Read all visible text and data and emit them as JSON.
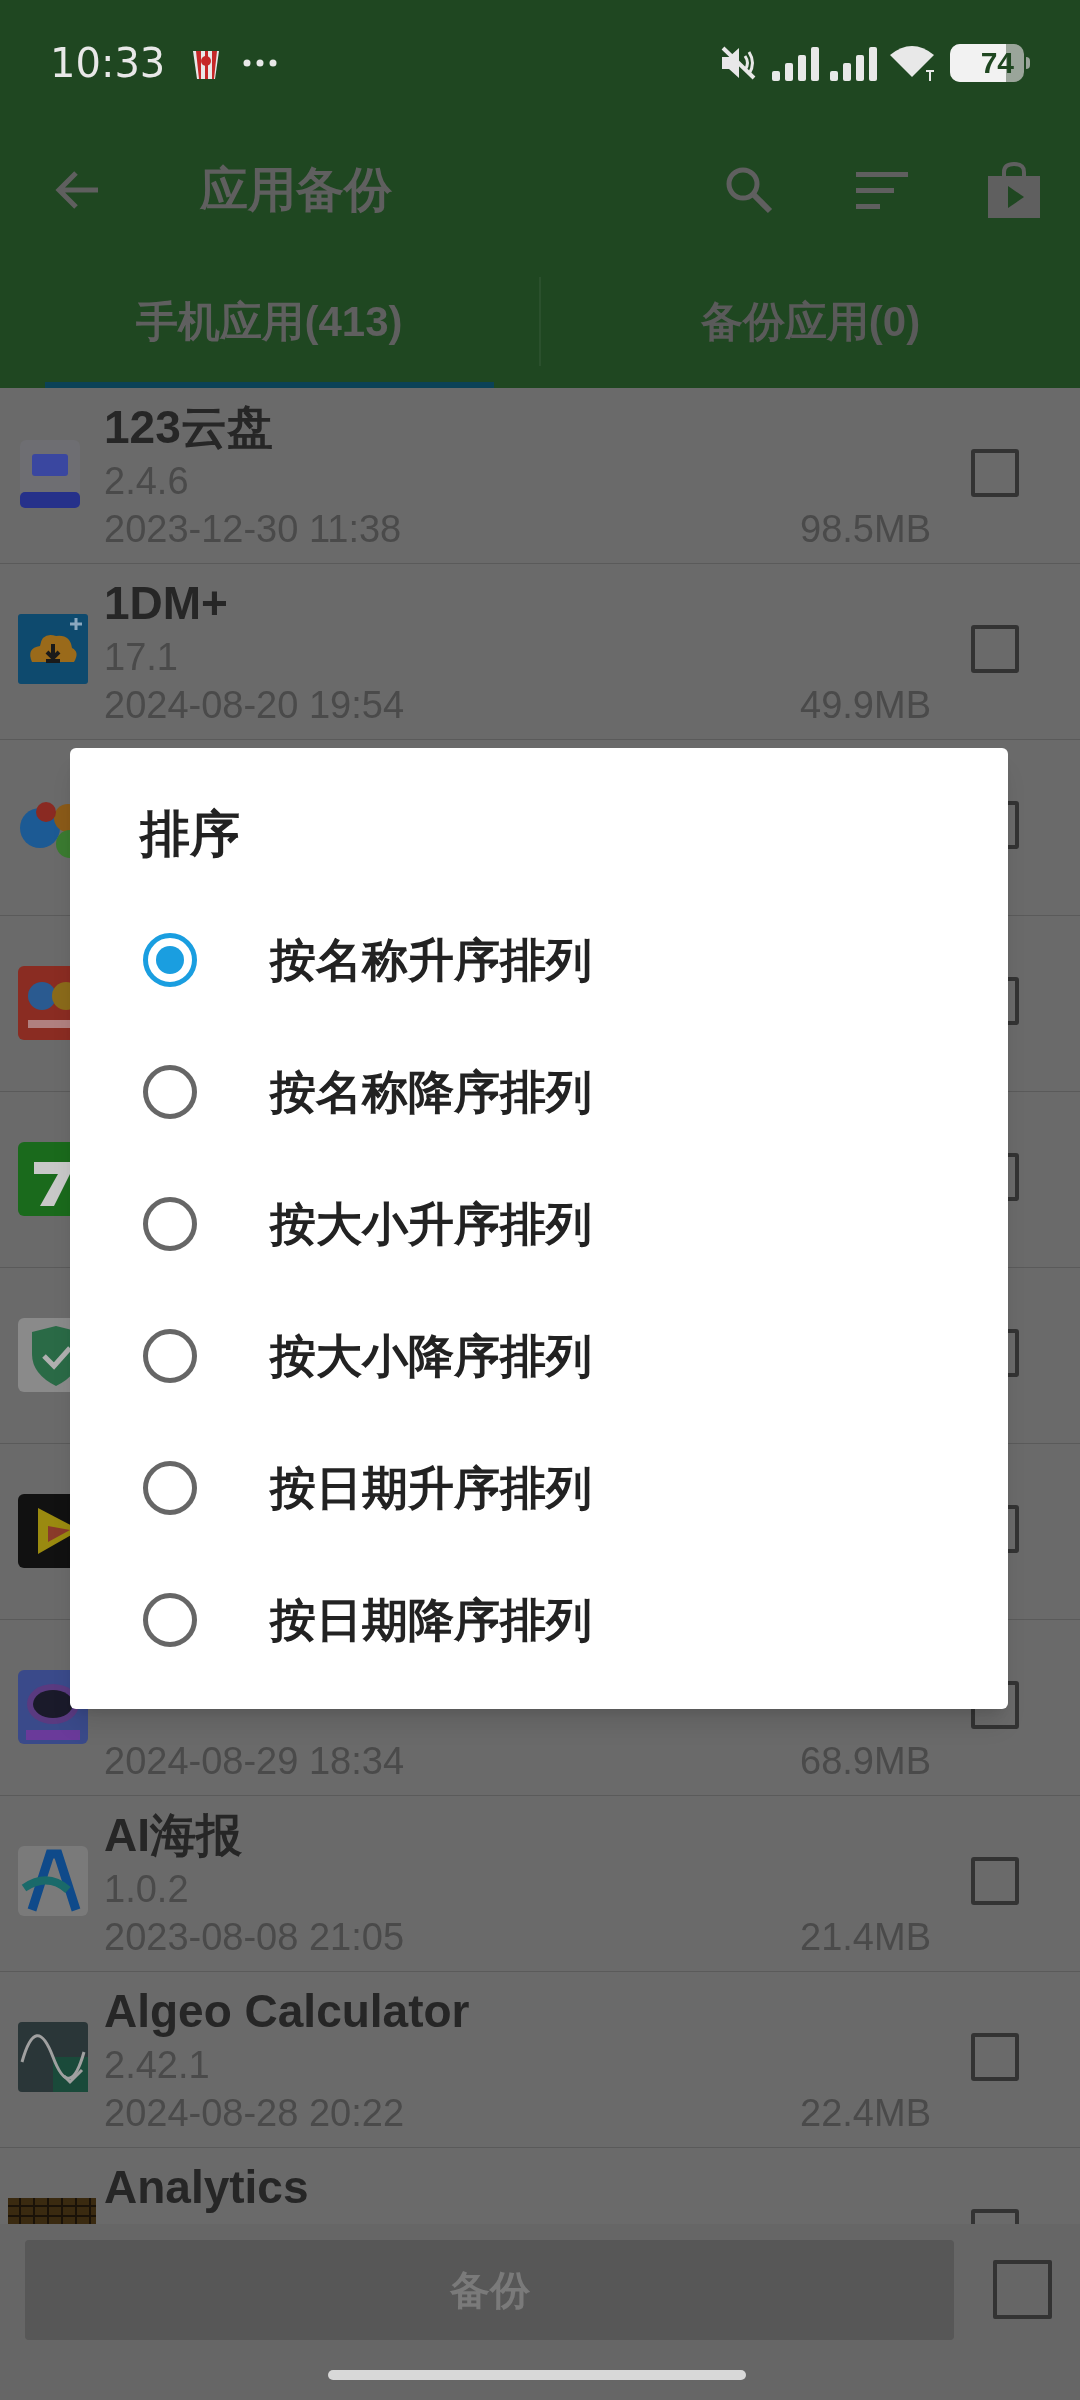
{
  "status_bar": {
    "time": "10:33",
    "battery": "74"
  },
  "toolbar": {
    "title": "应用备份"
  },
  "tabs": [
    {
      "label": "手机应用(413)",
      "selected": true
    },
    {
      "label": "备份应用(0)",
      "selected": false
    }
  ],
  "apps": [
    {
      "name": "123云盘",
      "version": "2.4.6",
      "date": "2023-12-30 11:38",
      "size": "98.5MB",
      "checked": false
    },
    {
      "name": "1DM+",
      "version": "17.1",
      "date": "2024-08-20 19:54",
      "size": "49.9MB",
      "checked": false
    },
    {
      "checked": false
    },
    {
      "checked": false
    },
    {
      "checked": false
    },
    {
      "checked": false
    },
    {
      "checked": false
    },
    {
      "date": "2024-08-29 18:34",
      "size": "68.9MB",
      "checked": false
    },
    {
      "name": "AI海报",
      "version": "1.0.2",
      "date": "2023-08-08 21:05",
      "size": "21.4MB",
      "checked": false
    },
    {
      "name": "Algeo Calculator",
      "version": "2.42.1",
      "date": "2024-08-28 20:22",
      "size": "22.4MB",
      "checked": false
    },
    {
      "name": "Analytics",
      "checked": false
    }
  ],
  "sort_dialog": {
    "title": "排序",
    "options": [
      {
        "label": "按名称升序排列",
        "selected": true
      },
      {
        "label": "按名称降序排列",
        "selected": false
      },
      {
        "label": "按大小升序排列",
        "selected": false
      },
      {
        "label": "按大小降序排列",
        "selected": false
      },
      {
        "label": "按日期升序排列",
        "selected": false
      },
      {
        "label": "按日期降序排列",
        "selected": false
      }
    ]
  },
  "bottom_bar": {
    "button": "备份",
    "select_all_checked": false
  }
}
